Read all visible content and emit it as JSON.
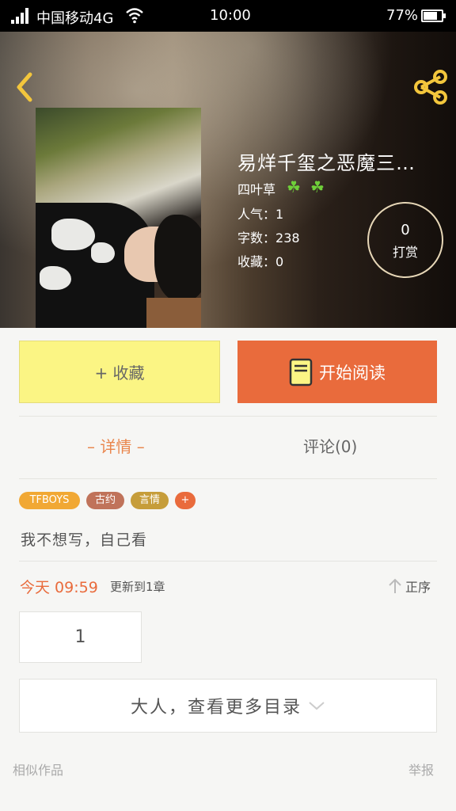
{
  "status_bar": {
    "carrier": "中国移动4G",
    "time": "10:00",
    "battery_percent": "77%",
    "battery_level": 0.77
  },
  "book": {
    "title": "易烊千玺之恶魔三…",
    "author": "四叶草",
    "popularity_label": "人气：",
    "popularity": "1",
    "word_count_label": "字数：",
    "word_count": "238",
    "favorites_label": "收藏：",
    "favorites": "0",
    "tip_count": "0",
    "tip_label": "打赏"
  },
  "actions": {
    "favorite_label": "+ 收藏",
    "read_label": "开始阅读"
  },
  "tabs": {
    "detail_label": "– 详情 –",
    "comments_label": "评论(0)"
  },
  "tags": [
    {
      "label": "TFBOYS",
      "color": "#f1a834"
    },
    {
      "label": "古约",
      "color": "#c0735a"
    },
    {
      "label": "言情",
      "color": "#c69d3a"
    },
    {
      "label": "+",
      "color": "#e96b3c"
    }
  ],
  "description": "我不想写，自己看",
  "update": {
    "time": "今天 09:59",
    "text": "更新到1章",
    "sort_label": "正序"
  },
  "chapter_page": "1",
  "more_catalog_label": "大人，查看更多目录",
  "footer": {
    "similar_label": "相似作品",
    "report_label": "举报"
  },
  "colors": {
    "accent_orange": "#e96b3c",
    "favorite_yellow": "#fbf584",
    "tab_active": "#e9864d",
    "share_icon": "#f3c63c",
    "clover": "#6fcf3a"
  }
}
